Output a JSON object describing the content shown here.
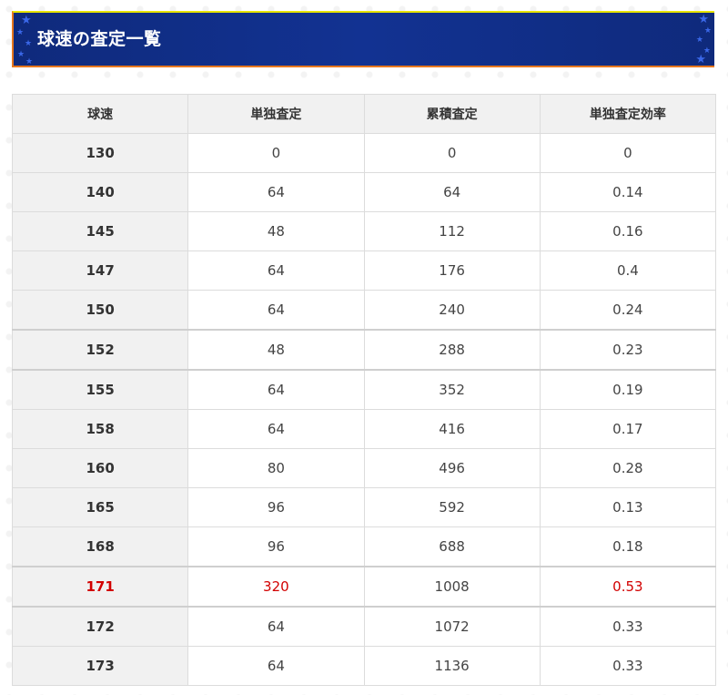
{
  "header": {
    "title": "球速の査定一覧"
  },
  "table": {
    "columns": [
      "球速",
      "単独査定",
      "累積査定",
      "単独査定効率"
    ],
    "rows": [
      {
        "speed": "130",
        "single": "0",
        "cumulative": "0",
        "efficiency": "0"
      },
      {
        "speed": "140",
        "single": "64",
        "cumulative": "64",
        "efficiency": "0.14"
      },
      {
        "speed": "145",
        "single": "48",
        "cumulative": "112",
        "efficiency": "0.16"
      },
      {
        "speed": "147",
        "single": "64",
        "cumulative": "176",
        "efficiency": "0.4"
      },
      {
        "speed": "150",
        "single": "64",
        "cumulative": "240",
        "efficiency": "0.24"
      },
      {
        "speed": "152",
        "single": "48",
        "cumulative": "288",
        "efficiency": "0.23"
      },
      {
        "speed": "155",
        "single": "64",
        "cumulative": "352",
        "efficiency": "0.19"
      },
      {
        "speed": "158",
        "single": "64",
        "cumulative": "416",
        "efficiency": "0.17"
      },
      {
        "speed": "160",
        "single": "80",
        "cumulative": "496",
        "efficiency": "0.28"
      },
      {
        "speed": "165",
        "single": "96",
        "cumulative": "592",
        "efficiency": "0.13"
      },
      {
        "speed": "168",
        "single": "96",
        "cumulative": "688",
        "efficiency": "0.18"
      },
      {
        "speed": "171",
        "single": "320",
        "cumulative": "1008",
        "efficiency": "0.53"
      },
      {
        "speed": "172",
        "single": "64",
        "cumulative": "1072",
        "efficiency": "0.33"
      },
      {
        "speed": "173",
        "single": "64",
        "cumulative": "1136",
        "efficiency": "0.33"
      }
    ]
  },
  "colors": {
    "header_background": "#123292",
    "header_border_top": "#e7e400",
    "header_border_accent": "#e7771d",
    "header_star": "#3a67e8",
    "highlight_text": "#d20000",
    "cell_shade": "#f1f1f1"
  },
  "icons": {
    "header_decoration": "star-icon"
  }
}
